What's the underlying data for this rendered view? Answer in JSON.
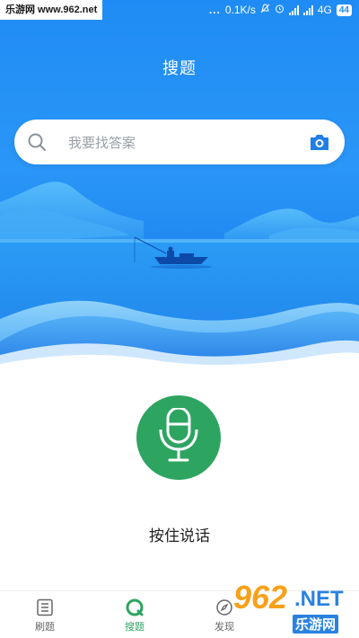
{
  "status_bar": {
    "watermark_text": "乐游网 www.962.net",
    "dots": "...",
    "speed": "0.1K/s",
    "network": "4G",
    "battery": "44"
  },
  "header": {
    "title": "搜题"
  },
  "search": {
    "placeholder": "我要找答案"
  },
  "voice": {
    "label": "按住说话"
  },
  "tabs": [
    {
      "label": "刷题",
      "icon": "list-icon",
      "active": false
    },
    {
      "label": "搜题",
      "icon": "search-tab-icon",
      "active": true
    },
    {
      "label": "发现",
      "icon": "compass-icon",
      "active": false
    }
  ],
  "watermark": {
    "number": "962",
    "net": ".NET",
    "cn": "乐游网"
  },
  "colors": {
    "primary_blue": "#1f8cf5",
    "accent_green": "#2ea461",
    "placeholder_gray": "#9aa0a8"
  }
}
